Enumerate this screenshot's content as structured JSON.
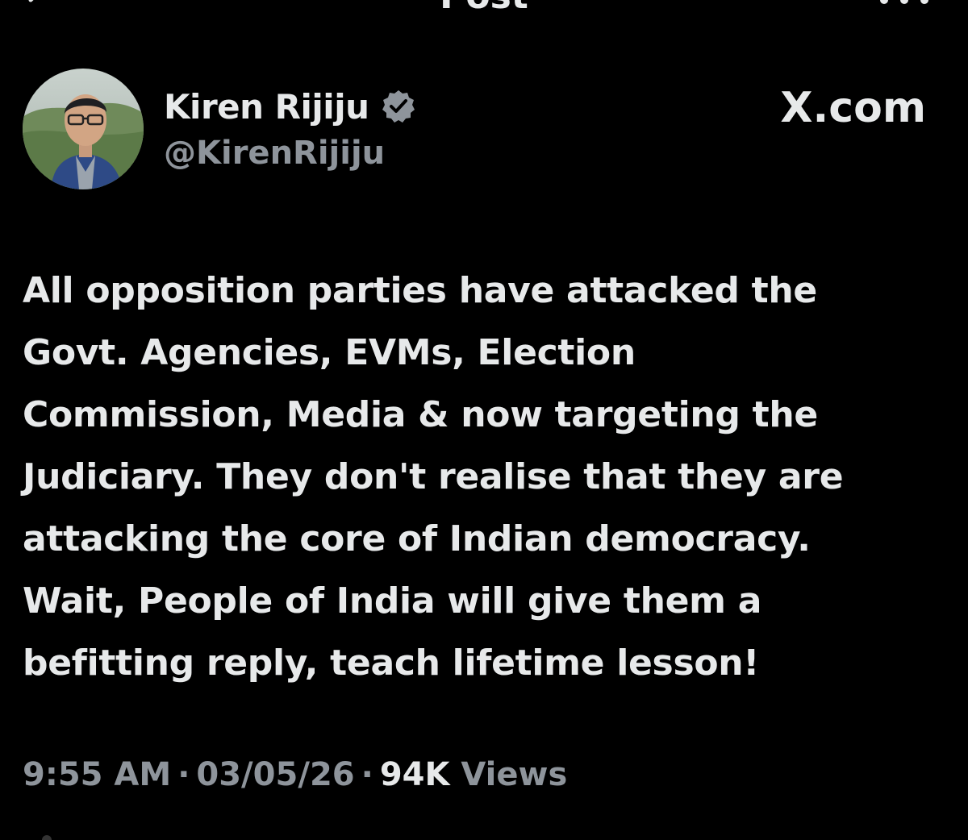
{
  "header": {
    "title": "Post",
    "back_icon": "arrow-left-icon",
    "more_icon": "more-horizontal-icon"
  },
  "author": {
    "display_name": "Kiren Rijiju",
    "handle": "@KirenRijiju",
    "verified": true,
    "verified_color": "#1d9bf0",
    "brand": "X.com"
  },
  "post": {
    "text": "All opposition parties have attacked the\nGovt. Agencies,  EVMs, Election\nCommission, Media & now targeting the\nJudiciary. They don't realise that they are\nattacking the core of Indian democracy.\nWait, People of India will give them a\nbefitting reply, teach lifetime lesson!"
  },
  "meta": {
    "time": "9:55 AM",
    "date": "03/05/26",
    "separator": "·",
    "views_count": "94K",
    "views_label": "Views"
  },
  "colors": {
    "background": "#000000",
    "primary_text": "#e7e9ea",
    "secondary_text": "#8e949b"
  }
}
